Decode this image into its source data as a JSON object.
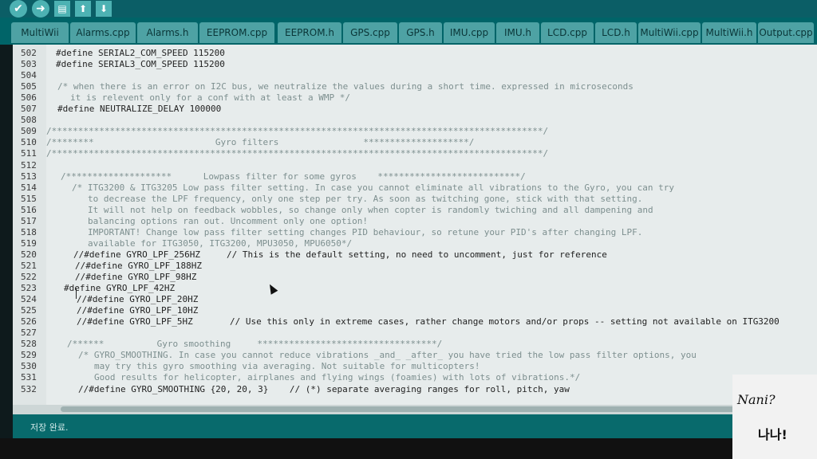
{
  "toolbar": {
    "buttons": [
      {
        "name": "verify-button",
        "glyph": "✔"
      },
      {
        "name": "upload-button",
        "glyph": "➜"
      },
      {
        "name": "new-button",
        "glyph": "▤"
      },
      {
        "name": "open-button",
        "glyph": "⬆"
      },
      {
        "name": "save-button",
        "glyph": "⬇"
      }
    ]
  },
  "tabs": [
    {
      "label": "MultiWii",
      "active": false
    },
    {
      "label": "Alarms.cpp",
      "active": false
    },
    {
      "label": "Alarms.h",
      "active": false
    },
    {
      "label": "EEPROM.cpp",
      "active": false
    },
    {
      "label": "EEPROM.h",
      "active": false
    },
    {
      "label": "GPS.cpp",
      "active": false
    },
    {
      "label": "GPS.h",
      "active": false
    },
    {
      "label": "IMU.cpp",
      "active": false
    },
    {
      "label": "IMU.h",
      "active": false
    },
    {
      "label": "LCD.cpp",
      "active": false
    },
    {
      "label": "LCD.h",
      "active": false
    },
    {
      "label": "MultiWii.cpp",
      "active": false
    },
    {
      "label": "MultiWii.h",
      "active": false
    },
    {
      "label": "Output.cpp",
      "active": false
    }
  ],
  "code_lines": [
    {
      "n": "502",
      "indent": 70,
      "text": "#define SERIAL2_COM_SPEED 115200",
      "comment": false
    },
    {
      "n": "503",
      "indent": 70,
      "text": "#define SERIAL3_COM_SPEED 115200",
      "comment": false
    },
    {
      "n": "504",
      "indent": 70,
      "text": "",
      "comment": false
    },
    {
      "n": "505",
      "indent": 72,
      "text": "/* when there is an error on I2C bus, we neutralize the values during a short time. expressed in microseconds",
      "comment": true
    },
    {
      "n": "506",
      "indent": 88,
      "text": "it is relevent only for a conf with at least a WMP */",
      "comment": true
    },
    {
      "n": "507",
      "indent": 72,
      "text": "#define NEUTRALIZE_DELAY 100000",
      "comment": false
    },
    {
      "n": "508",
      "indent": 72,
      "text": "",
      "comment": false
    },
    {
      "n": "509",
      "indent": 58,
      "text": "/*********************************************************************************************/",
      "comment": true
    },
    {
      "n": "510",
      "indent": 58,
      "text": "/********                       Gyro filters                ********************/",
      "comment": true
    },
    {
      "n": "511",
      "indent": 58,
      "text": "/*********************************************************************************************/",
      "comment": true
    },
    {
      "n": "512",
      "indent": 58,
      "text": "",
      "comment": false
    },
    {
      "n": "513",
      "indent": 76,
      "text": "/********************      Lowpass filter for some gyros    ***************************/",
      "comment": true
    },
    {
      "n": "514",
      "indent": 90,
      "text": "/* ITG3200 & ITG3205 Low pass filter setting. In case you cannot eliminate all vibrations to the Gyro, you can try",
      "comment": true
    },
    {
      "n": "515",
      "indent": 110,
      "text": "to decrease the LPF frequency, only one step per try. As soon as twitching gone, stick with that setting.",
      "comment": true
    },
    {
      "n": "516",
      "indent": 110,
      "text": "It will not help on feedback wobbles, so change only when copter is randomly twiching and all dampening and",
      "comment": true
    },
    {
      "n": "517",
      "indent": 110,
      "text": "balancing options ran out. Uncomment only one option!",
      "comment": true
    },
    {
      "n": "518",
      "indent": 110,
      "text": "IMPORTANT! Change low pass filter setting changes PID behaviour, so retune your PID's after changing LPF.",
      "comment": true
    },
    {
      "n": "519",
      "indent": 110,
      "text": "available for ITG3050, ITG3200, MPU3050, MPU6050*/",
      "comment": true
    },
    {
      "n": "520",
      "indent": 92,
      "text": "//#define GYRO_LPF_256HZ     // This is the default setting, no need to uncomment, just for reference",
      "comment": false
    },
    {
      "n": "521",
      "indent": 94,
      "text": "//#define GYRO_LPF_188HZ",
      "comment": false
    },
    {
      "n": "522",
      "indent": 94,
      "text": "//#define GYRO_LPF_98HZ",
      "comment": false
    },
    {
      "n": "523",
      "indent": 80,
      "text": "#define GYRO_LPF_42HZ",
      "comment": false
    },
    {
      "n": "524",
      "indent": 96,
      "text": "//#define GYRO_LPF_20HZ",
      "comment": false
    },
    {
      "n": "525",
      "indent": 96,
      "text": "//#define GYRO_LPF_10HZ",
      "comment": false
    },
    {
      "n": "526",
      "indent": 96,
      "text": "//#define GYRO_LPF_5HZ       // Use this only in extreme cases, rather change motors and/or props -- setting not available on ITG3200",
      "comment": false
    },
    {
      "n": "527",
      "indent": 96,
      "text": "",
      "comment": false
    },
    {
      "n": "528",
      "indent": 84,
      "text": "/******          Gyro smoothing     **********************************/",
      "comment": true
    },
    {
      "n": "529",
      "indent": 98,
      "text": "/* GYRO_SMOOTHING. In case you cannot reduce vibrations _and_ _after_ you have tried the low pass filter options, you",
      "comment": true
    },
    {
      "n": "530",
      "indent": 118,
      "text": "may try this gyro smoothing via averaging. Not suitable for multicopters!",
      "comment": true
    },
    {
      "n": "531",
      "indent": 118,
      "text": "Good results for helicopter, airplanes and flying wings (foamies) with lots of vibrations.*/",
      "comment": true
    },
    {
      "n": "532",
      "indent": 98,
      "text": "//#define GYRO_SMOOTHING {20, 20, 3}    // (*) separate averaging ranges for roll, pitch, yaw",
      "comment": false
    }
  ],
  "status": {
    "message": "저장 완료."
  },
  "watermark": {
    "line1": "Nani?",
    "line2": "나나!"
  }
}
